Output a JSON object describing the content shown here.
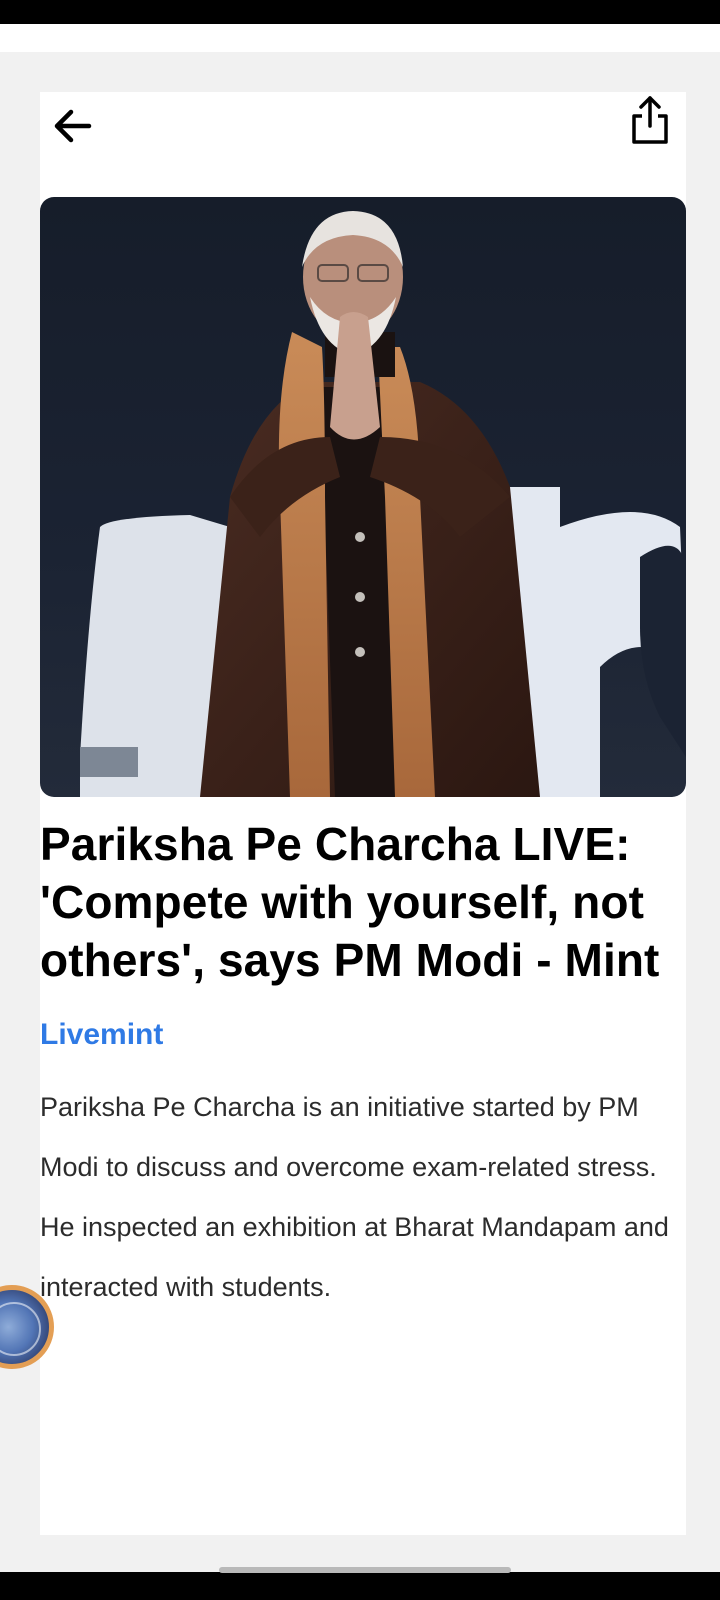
{
  "header": {
    "back_icon": "arrow-left-icon",
    "share_icon": "share-icon"
  },
  "article": {
    "image_alt": "PM Modi greeting with folded hands on stage",
    "title": "Pariksha Pe Charcha LIVE: 'Compete with yourself, not others', says PM Modi - Mint",
    "source": "Livemint",
    "summary": "Pariksha Pe Charcha is an initiative started by PM Modi to discuss and overcome exam-related stress. He inspected an exhibition at Bharat Mandapam and interacted with students."
  },
  "colors": {
    "source_link": "#2f7ae5",
    "page_background": "#f1f1f1",
    "card_background": "#ffffff"
  }
}
